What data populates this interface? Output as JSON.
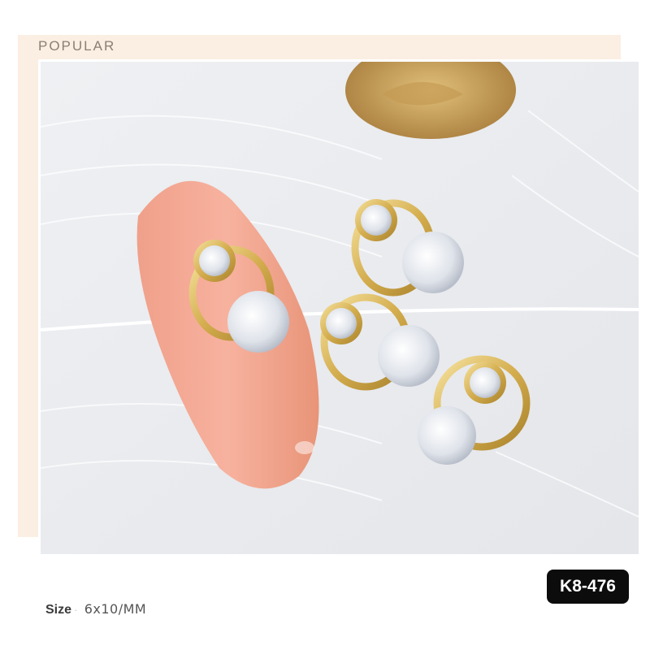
{
  "header": {
    "label": "POPULAR"
  },
  "product": {
    "sku": "K8-476",
    "size_label": "Size",
    "size_value": "6x10/MM"
  },
  "colors": {
    "accent_panel": "#fbeee2",
    "badge_bg": "#0c0c0c",
    "nail": "#f4a792",
    "gold": "#d9b85a"
  },
  "photo": {
    "subject_icon": "nail-charm-photo"
  }
}
